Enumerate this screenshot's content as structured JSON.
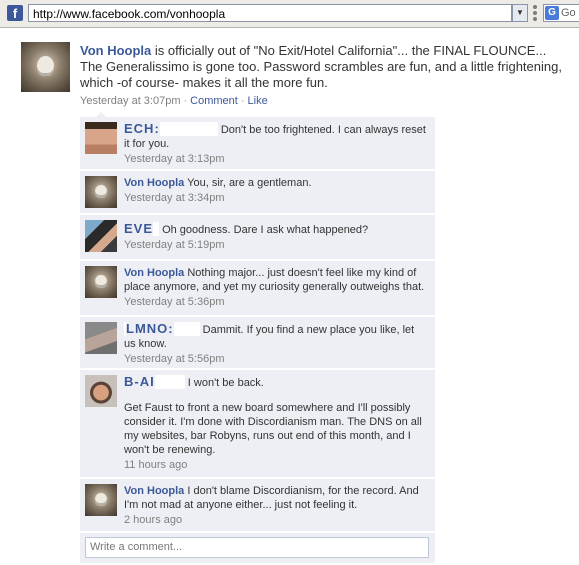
{
  "browser": {
    "favicon_glyph": "f",
    "url": "http://www.facebook.com/vonhoopla",
    "search_partial": "Go"
  },
  "post": {
    "author": "Von Hoopla",
    "text": "is officially out of \"No Exit/Hotel California\"... the FINAL FLOUNCE... The Generalissimo is gone too. Password scrambles are fun, and a little frightening, which -of course- makes it all the more fun.",
    "time": "Yesterday at 3:07pm",
    "comment_label": "Comment",
    "like_label": "Like"
  },
  "comments": [
    {
      "name": "ECH:",
      "text": "Don't be too frightened. I can always reset it for you.",
      "time": "Yesterday at 3:13pm"
    },
    {
      "name": "Von Hoopla",
      "text": "You, sir, are a gentleman.",
      "time": "Yesterday at 3:34pm"
    },
    {
      "name": "EVE",
      "text": "Oh goodness. Dare I ask what happened?",
      "time": "Yesterday at 5:19pm"
    },
    {
      "name": "Von Hoopla",
      "text": "Nothing major... just doesn't feel like my kind of place anymore, and yet my curiosity generally outweighs that.",
      "time": "Yesterday at 5:36pm"
    },
    {
      "name": "LMNO:",
      "text": "Dammit. If you find a new place you like, let us know.",
      "time": "Yesterday at 5:56pm"
    },
    {
      "name": "B-AI",
      "text": "I won't be back.",
      "text2": "Get Faust to front a new board somewhere and I'll possibly consider it. I'm done with Discordianism man. The DNS on all my websites, bar Robyns, runs out end of this month, and I won't be renewing.",
      "time": "11 hours ago"
    },
    {
      "name": "Von Hoopla",
      "text": "I don't blame Discordianism, for the record. And I'm not mad at anyone either... just not feeling it.",
      "time": "2 hours ago"
    }
  ],
  "write_comment": {
    "placeholder": "Write a comment..."
  },
  "colors": {
    "link": "#3b5998",
    "comment_bg": "#edeff4",
    "meta": "#808080"
  }
}
